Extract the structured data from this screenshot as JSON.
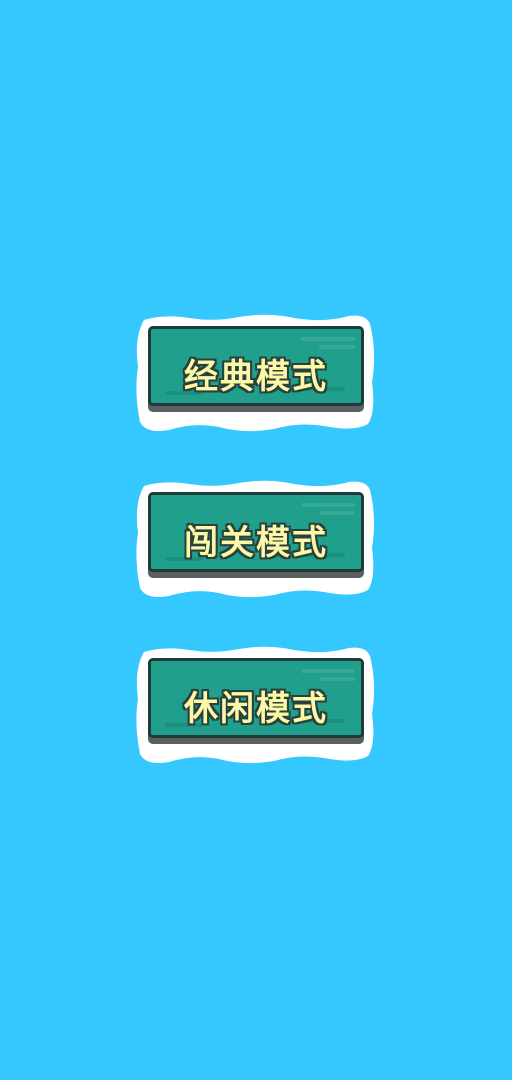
{
  "background_color": "#35c8ff",
  "menu": {
    "buttons": [
      {
        "label": "经典模式"
      },
      {
        "label": "闯关模式"
      },
      {
        "label": "休闲模式"
      }
    ]
  }
}
